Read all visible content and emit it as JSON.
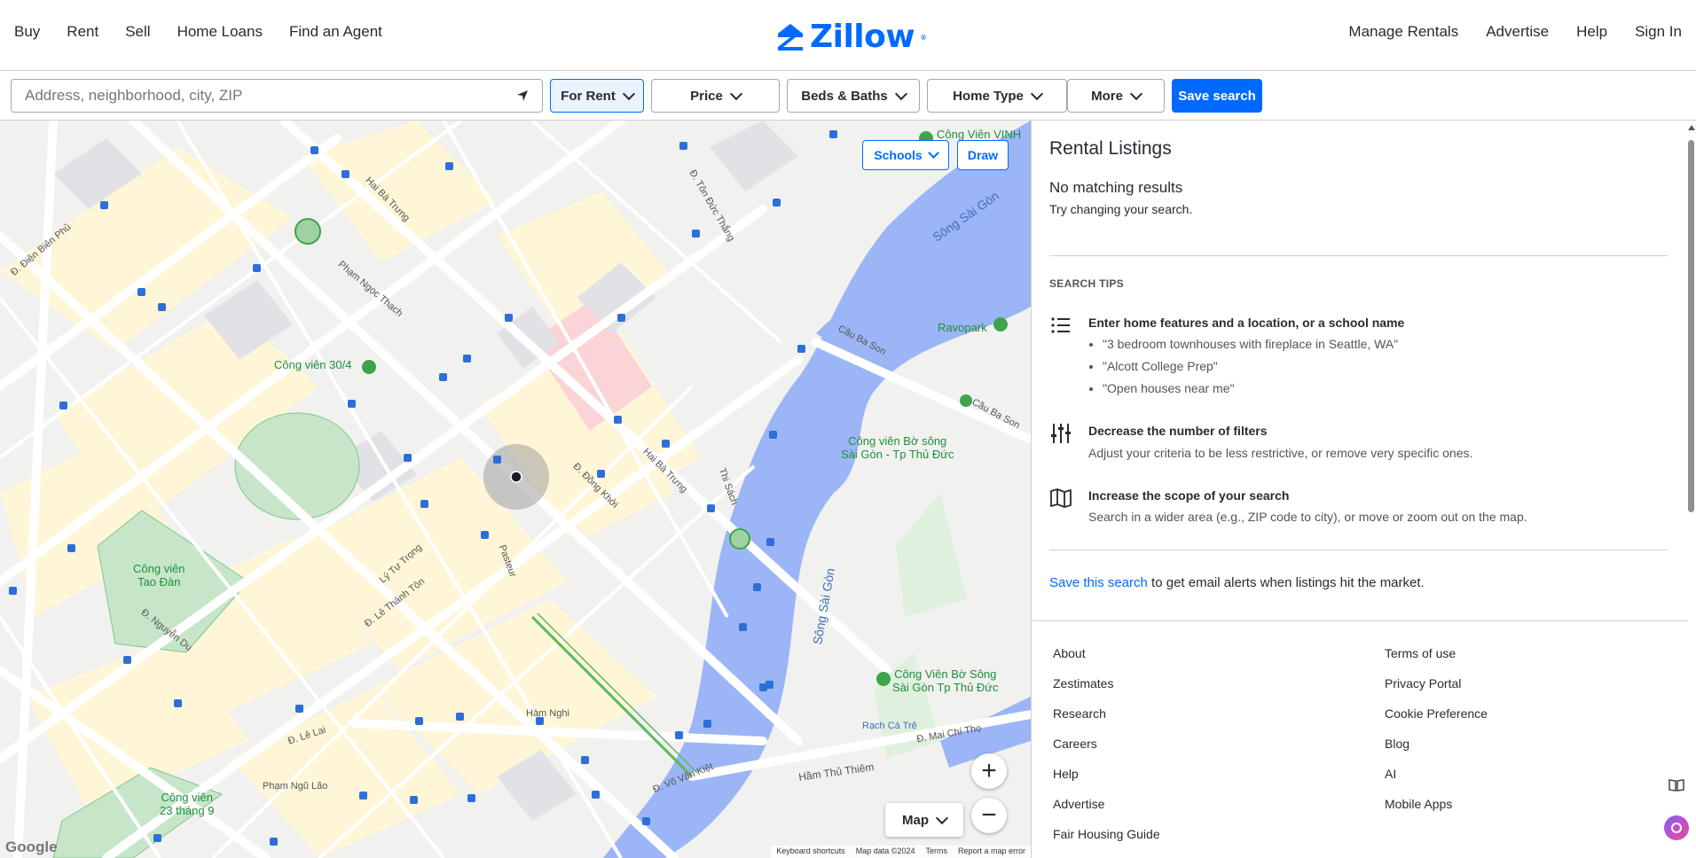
{
  "header": {
    "nav_left": [
      "Buy",
      "Rent",
      "Sell",
      "Home Loans",
      "Find an Agent"
    ],
    "logo_text": "Zillow",
    "nav_right": [
      "Manage Rentals",
      "Advertise",
      "Help",
      "Sign In"
    ],
    "brand_color": "#006aff"
  },
  "search": {
    "placeholder": "Address, neighborhood, city, ZIP",
    "value": ""
  },
  "filters": {
    "for_rent": "For Rent",
    "price": "Price",
    "beds_baths": "Beds & Baths",
    "home_type": "Home Type",
    "more": "More",
    "save_search": "Save search"
  },
  "map": {
    "schools": "Schools",
    "draw": "Draw",
    "map_type": "Map",
    "zoom_in": "+",
    "zoom_out": "−",
    "google": "Google",
    "attribution": [
      "Keyboard shortcuts",
      "Map data ©2024",
      "Terms",
      "Report a map error"
    ],
    "labels": {
      "cong_vien_30_4": "Công viên 30/4",
      "cong_vien_tao_dan": "Công viên\nTao Đàn",
      "cong_vien_23_thang_9": "Công viên\n23 tháng 9",
      "cong_vien_bo_song": "Công viên Bờ sông\nSài Gòn - Tp Thủ Đức",
      "cong_vien_bo_song_2": "Công Viên Bờ Sông\nSài Gòn Tp Thủ Đức",
      "cong_vien_vinh": "Công Viên VINH",
      "ravopark": "Ravopark",
      "song_sai_gon_1": "Sông Sài Gòn",
      "song_sai_gon_2": "Sông Sài Gòn",
      "rach_ca_tre": "Rạch Cá Trê",
      "ham_thu_thiem": "Hầm Thủ Thiêm",
      "cau_ba_son_1": "Cầu Ba Son",
      "cau_ba_son_2": "Cầu Ba Son",
      "ham_nghi": "Hàm Nghi",
      "hai_ba_trung_1": "Hai Bà Trưng",
      "hai_ba_trung_2": "Hai Bà Trưng",
      "le_thanh_ton": "Đ. Lê Thánh Tôn",
      "ly_tu_trong": "Lý Tự Trọng",
      "pham_ngoc_thach": "Phạm Ngọc Thạch",
      "pasteur": "Pasteur",
      "dong_khoi": "Đ. Đồng Khởi",
      "nguyen_du": "Đ. Nguyễn Du",
      "pham_ngu_lao": "Phạm Ngũ Lão",
      "le_lai": "Đ. Lê Lai",
      "vo_van_kiet": "Đ. Võ Văn Kiệt",
      "ton_duc_thang": "Đ. Tôn Đức Thắng",
      "dien_bien_phu": "Đ. Điện Biên Phủ",
      "mai_chi_tho": "Đ. Mai Chí Thọ",
      "thi_sach": "Thi Sách"
    }
  },
  "panel": {
    "title": "Rental Listings",
    "no_results": "No matching results",
    "try_changing": "Try changing your search.",
    "tips_heading": "SEARCH TIPS",
    "tip1_title": "Enter home features and a location, or a school name",
    "tip1_examples": [
      "\"3 bedroom townhouses with fireplace in Seattle, WA\"",
      "\"Alcott College Prep\"",
      "\"Open houses near me\""
    ],
    "tip2_title": "Decrease the number of filters",
    "tip2_desc": "Adjust your criteria to be less restrictive, or remove very specific ones.",
    "tip3_title": "Increase the scope of your search",
    "tip3_desc": "Search in a wider area (e.g., ZIP code to city), or move or zoom out on the map.",
    "save_link": "Save this search",
    "save_rest": " to get email alerts when listings hit the market.",
    "footer_left": [
      "About",
      "Zestimates",
      "Research",
      "Careers",
      "Help",
      "Advertise",
      "Fair Housing Guide"
    ],
    "footer_right": [
      "Terms of use",
      "Privacy Portal",
      "Cookie Preference",
      "Blog",
      "AI",
      "Mobile Apps"
    ]
  }
}
